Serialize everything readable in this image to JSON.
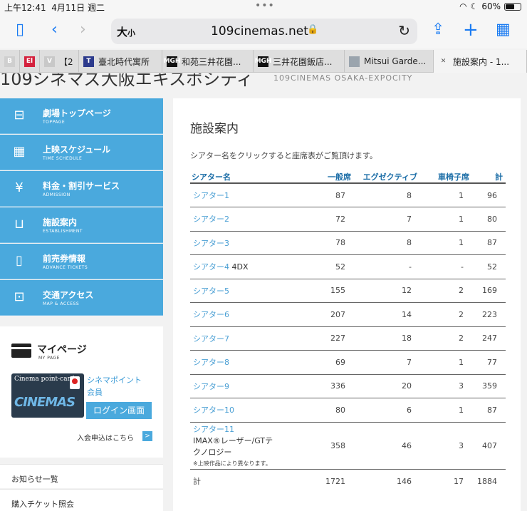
{
  "status": {
    "time": "上午12:41",
    "date": "4月11日 週二",
    "battery": "60%",
    "battery_level": 0.6
  },
  "toolbar": {
    "text_size": "大",
    "text_size_small": "小",
    "url": "109cinemas.net"
  },
  "tabs": [
    {
      "label": "",
      "fav": "B",
      "fav_color": "#cfcfcf"
    },
    {
      "label": "",
      "fav": "El",
      "fav_color": "#d4213d"
    },
    {
      "label": "【2",
      "fav": "V",
      "fav_color": "#c8c8c8"
    },
    {
      "label": "臺北時代寓所",
      "fav": "T",
      "fav_color": "#2c3a8c"
    },
    {
      "label": "和苑三井花園...",
      "fav": "MGH",
      "fav_color": "#111111"
    },
    {
      "label": "三井花園飯店...",
      "fav": "MGH",
      "fav_color": "#111111"
    },
    {
      "label": "Mitsui Garde...",
      "fav": "",
      "fav_color": "#9aa4ad"
    },
    {
      "label": "施設案内 - 1...",
      "fav": "✕",
      "fav_color": "#555555"
    }
  ],
  "site": {
    "title": "109シネマズ大阪エキスポシティ",
    "subtitle": "109CINEMAS OSAKA-EXPOCITY"
  },
  "nav": [
    {
      "jp": "劇場トップページ",
      "en": "TOPPAGE",
      "icon": "ticket-icon"
    },
    {
      "jp": "上映スケジュール",
      "en": "TIME SCHEDULE",
      "icon": "calendar-icon"
    },
    {
      "jp": "料金・割引サービス",
      "en": "ADMISSION",
      "icon": "yen-icon"
    },
    {
      "jp": "施設案内",
      "en": "ESTABLISHMENT",
      "icon": "seat-icon"
    },
    {
      "jp": "前売券情報",
      "en": "ADVANCE TICKETS",
      "icon": "phone-ticket-icon"
    },
    {
      "jp": "交通アクセス",
      "en": "MAP & ACCESS",
      "icon": "train-icon"
    }
  ],
  "mypage": {
    "title": "マイページ",
    "en": "MY PAGE",
    "card_line": "Cinema point-card",
    "card_big": "CINEMAS",
    "point_line1": "シネマポイント",
    "point_line2": "会員",
    "login": "ログイン画面",
    "apply": "入会申込はこちら",
    "apply_arrow": ">"
  },
  "links": [
    "お知らせ一覧",
    "購入チケット照会"
  ],
  "main": {
    "title": "施設案内",
    "intro": "シアター名をクリックすると座席表がご覧頂けます。",
    "headers": [
      "シアター名",
      "一般席",
      "エグゼクティブ",
      "車椅子席",
      "計"
    ],
    "rows": [
      {
        "name": "シアター1",
        "note": "",
        "general": "87",
        "exec": "8",
        "wheel": "1",
        "total": "96"
      },
      {
        "name": "シアター2",
        "note": "",
        "general": "72",
        "exec": "7",
        "wheel": "1",
        "total": "80"
      },
      {
        "name": "シアター3",
        "note": "",
        "general": "78",
        "exec": "8",
        "wheel": "1",
        "total": "87"
      },
      {
        "name": "シアター4",
        "note": "4DX",
        "general": "52",
        "exec": "-",
        "wheel": "-",
        "total": "52"
      },
      {
        "name": "シアター5",
        "note": "",
        "general": "155",
        "exec": "12",
        "wheel": "2",
        "total": "169"
      },
      {
        "name": "シアター6",
        "note": "",
        "general": "207",
        "exec": "14",
        "wheel": "2",
        "total": "223"
      },
      {
        "name": "シアター7",
        "note": "",
        "general": "227",
        "exec": "18",
        "wheel": "2",
        "total": "247"
      },
      {
        "name": "シアター8",
        "note": "",
        "general": "69",
        "exec": "7",
        "wheel": "1",
        "total": "77"
      },
      {
        "name": "シアター9",
        "note": "",
        "general": "336",
        "exec": "20",
        "wheel": "3",
        "total": "359"
      },
      {
        "name": "シアター10",
        "note": "",
        "general": "80",
        "exec": "6",
        "wheel": "1",
        "total": "87"
      }
    ],
    "theater11": {
      "name": "シアター11",
      "tech": "IMAX®レーザー/GTテクノロジー",
      "small": "※上映作品により異なります。",
      "general": "358",
      "exec": "46",
      "wheel": "3",
      "total": "407"
    },
    "total": {
      "label": "計",
      "general": "1721",
      "exec": "146",
      "wheel": "17",
      "total": "1884"
    }
  }
}
